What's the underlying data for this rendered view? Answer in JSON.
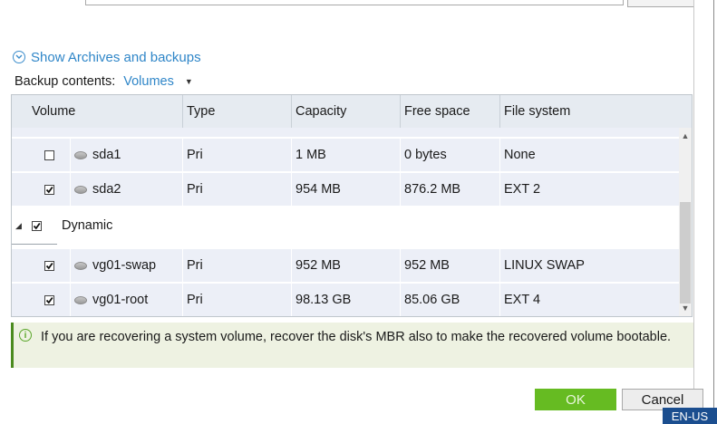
{
  "archives_link": {
    "label": "Show Archives and backups",
    "icon": "chevron-down-circle-icon"
  },
  "backup_contents": {
    "label": "Backup contents:",
    "value": "Volumes"
  },
  "table": {
    "columns": [
      "Volume",
      "Type",
      "Capacity",
      "Free space",
      "File system"
    ],
    "rows": [
      {
        "checked": false,
        "name": "sda1",
        "type": "Pri",
        "capacity": "1 MB",
        "free": "0 bytes",
        "fs": "None"
      },
      {
        "checked": true,
        "name": "sda2",
        "type": "Pri",
        "capacity": "954 MB",
        "free": "876.2 MB",
        "fs": "EXT 2"
      }
    ],
    "group": {
      "checked": true,
      "label": "Dynamic",
      "expanded": true
    },
    "group_rows": [
      {
        "checked": true,
        "name": "vg01-swap",
        "type": "Pri",
        "capacity": "952 MB",
        "free": "952 MB",
        "fs": "LINUX SWAP"
      },
      {
        "checked": true,
        "name": "vg01-root",
        "type": "Pri",
        "capacity": "98.13 GB",
        "free": "85.06 GB",
        "fs": "EXT 4"
      }
    ]
  },
  "info_message": "If you are recovering a system volume, recover the disk's MBR also to make the recovered volume bootable.",
  "buttons": {
    "ok": "OK",
    "cancel": "Cancel"
  },
  "language": "EN-US",
  "colors": {
    "accent": "#2f86c8",
    "ok": "#66bb22",
    "info_bar": "#4b8b1f",
    "lang_bg": "#1b4e8f"
  }
}
